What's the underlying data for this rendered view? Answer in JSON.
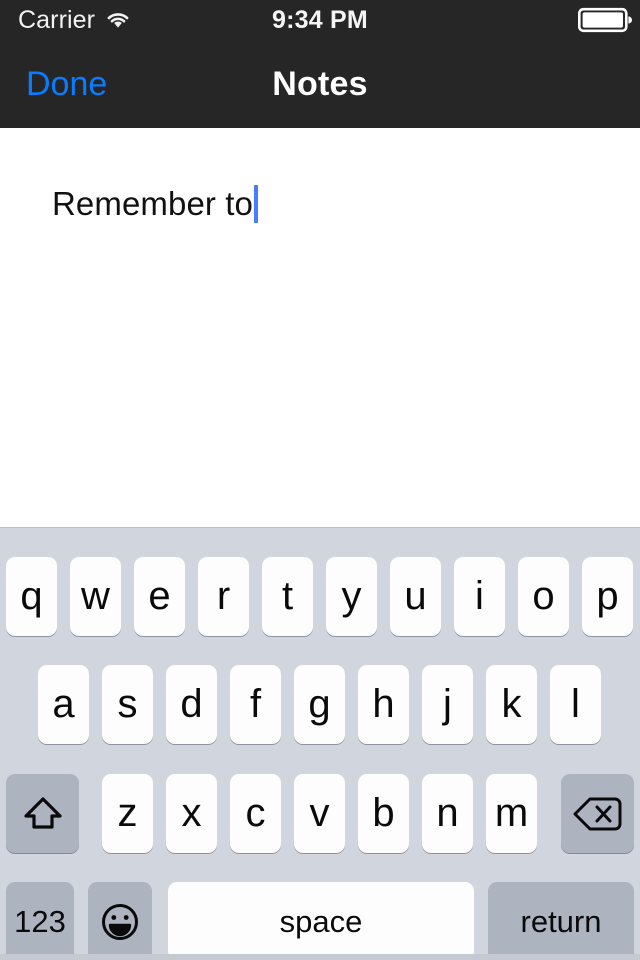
{
  "status_bar": {
    "carrier": "Carrier",
    "wifi_icon": "wifi-icon",
    "time": "9:34 PM",
    "battery_icon": "battery-full-icon"
  },
  "nav_bar": {
    "done_label": "Done",
    "title": "Notes",
    "done_color": "#0a7cff",
    "background_color": "#262626"
  },
  "note": {
    "text": "Remember to",
    "caret_color": "#4a7dfc"
  },
  "keyboard": {
    "background_color": "#d1d5dd",
    "key_color": "#fdfdfd",
    "special_key_color": "#adb4c0",
    "row1": [
      "q",
      "w",
      "e",
      "r",
      "t",
      "y",
      "u",
      "i",
      "o",
      "p"
    ],
    "row2": [
      "a",
      "s",
      "d",
      "f",
      "g",
      "h",
      "j",
      "k",
      "l"
    ],
    "row3_letters": [
      "z",
      "x",
      "c",
      "v",
      "b",
      "n",
      "m"
    ],
    "shift_icon": "shift-arrow-icon",
    "backspace_icon": "backspace-delete-icon",
    "numbers_label": "123",
    "emoji_icon": "smiley-face-icon",
    "space_label": "space",
    "return_label": "return"
  }
}
